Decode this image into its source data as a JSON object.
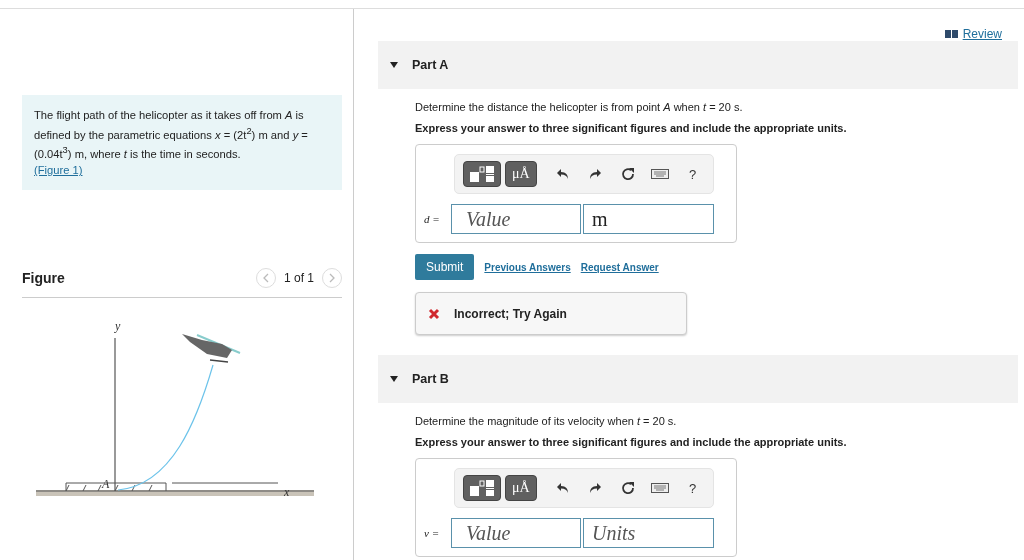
{
  "review_link": "Review",
  "problem": {
    "statement": "The flight path of the helicopter as it takes off from *A* is defined by the parametric equations *x* = (2t$^{2}$) m and *y* = (0.04t$^{3}$) m, where *t* is the time in seconds.",
    "figure_link": "(Figure 1)"
  },
  "figure": {
    "title": "Figure",
    "pager": "1 of 1",
    "prev_disabled": true,
    "next_disabled": true,
    "labels": {
      "y_axis": "y",
      "origin": "A",
      "x_axis": "x"
    }
  },
  "parts": [
    {
      "title": "Part A",
      "expanded": true,
      "question": "Determine the distance the helicopter is from point *A* when *t* = 20 s.",
      "instruction": "Express your answer to three significant figures and include the appropriate units.",
      "toolbar": {
        "units_button": "μÅ",
        "help": "?"
      },
      "variable": "d =",
      "value_placeholder": "Value",
      "units_value": "m",
      "submit": "Submit",
      "links": [
        "Previous Answers",
        "Request Answer"
      ],
      "feedback": {
        "kind": "incorrect",
        "text": "Incorrect; Try Again"
      }
    },
    {
      "title": "Part B",
      "expanded": true,
      "question": "Determine the magnitude of its velocity when *t* = 20 s.",
      "instruction": "Express your answer to three significant figures and include the appropriate units.",
      "toolbar": {
        "units_button": "μÅ",
        "help": "?"
      },
      "variable": "v =",
      "value_placeholder": "Value",
      "units_placeholder": "Units"
    }
  ]
}
